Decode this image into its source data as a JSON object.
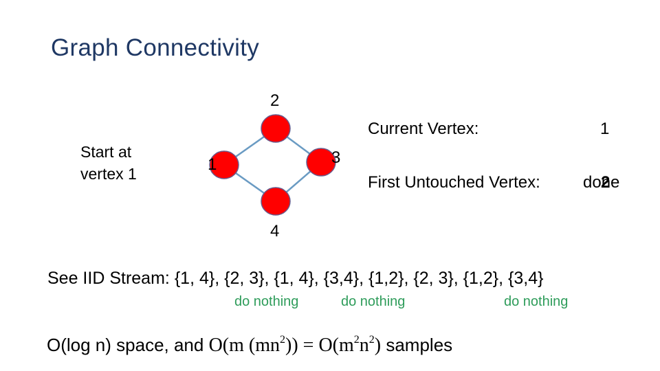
{
  "slide": {
    "title": "Graph Connectivity",
    "start_note": [
      "Start at",
      "vertex 1"
    ]
  },
  "graph": {
    "vertices": [
      {
        "id": "1",
        "label": "1"
      },
      {
        "id": "2",
        "label": "2"
      },
      {
        "id": "3",
        "label": "3"
      },
      {
        "id": "4",
        "label": "4"
      }
    ],
    "edges": [
      [
        "1",
        "2"
      ],
      [
        "2",
        "3"
      ],
      [
        "3",
        "4"
      ],
      [
        "1",
        "4"
      ]
    ],
    "node_fill": "#ff0000",
    "node_stroke": "#6a5a8a",
    "edge_color": "#6a9bc3"
  },
  "status": {
    "current_vertex_label": "Current Vertex:",
    "current_vertex_value": "1",
    "first_untouched_label": "First Untouched Vertex:",
    "first_untouched_value": "done",
    "first_untouched_overlay": "2"
  },
  "stream": {
    "label": "See IID Stream:",
    "items": "{1, 4}, {2, 3}, {1, 4}, {3,4}, {1,2}, {2, 3}, {1,2}, {3,4}",
    "annotations": [
      {
        "text": "do nothing",
        "under_item": 3
      },
      {
        "text": "do nothing",
        "under_item": 4
      },
      {
        "text": "do nothing",
        "under_item": 6
      }
    ],
    "annotation_color": "#2e9c5a"
  },
  "complexity": {
    "prefix": "O(log n) space, and ",
    "math_part1": "O(m (mn",
    "sup1": "2",
    "math_part2": ")) = O(m",
    "sup2": "2",
    "math_part3": "n",
    "sup3": "2",
    "math_part4": ")",
    "suffix": " samples"
  }
}
